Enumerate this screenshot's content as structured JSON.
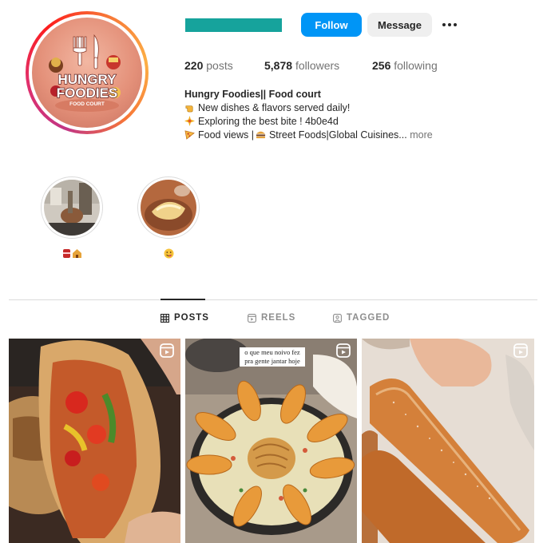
{
  "profile": {
    "avatar_text_line1": "HUNGRY",
    "avatar_text_line2": "FOODIES",
    "avatar_text_line3": "FOOD COURT"
  },
  "header": {
    "follow_label": "Follow",
    "message_label": "Message",
    "options_icon": "more-horizontal-icon"
  },
  "stats": {
    "posts_count": "220",
    "posts_label": "posts",
    "followers_count": "5,878",
    "followers_label": "followers",
    "following_count": "256",
    "following_label": "following"
  },
  "bio": {
    "name": "Hungry Foodies|| Food court",
    "line1": "New dishes & flavors served daily!",
    "line2": "Exploring the best bite ! 4b0e4d",
    "line3": "Food views |",
    "line3b": "Street Foods|Global Cuisines...",
    "more": "more"
  },
  "highlights": [
    {
      "label_icons": [
        "drink-can-icon",
        "house-icon"
      ]
    },
    {
      "label_icons": [
        "yum-face-icon"
      ]
    }
  ],
  "tabs": [
    {
      "label": "POSTS",
      "icon": "grid-icon",
      "active": true
    },
    {
      "label": "REELS",
      "icon": "reels-icon",
      "active": false
    },
    {
      "label": "TAGGED",
      "icon": "tagged-icon",
      "active": false
    }
  ],
  "posts": [
    {
      "type": "reel",
      "caption": ""
    },
    {
      "type": "reel",
      "caption": "o que meu noivo fez pra gente jantar hoje"
    },
    {
      "type": "reel",
      "caption": ""
    }
  ],
  "colors": {
    "follow_button": "#0095f6",
    "handle_redaction": "#16a39c",
    "story_ring": "#e1306c"
  }
}
